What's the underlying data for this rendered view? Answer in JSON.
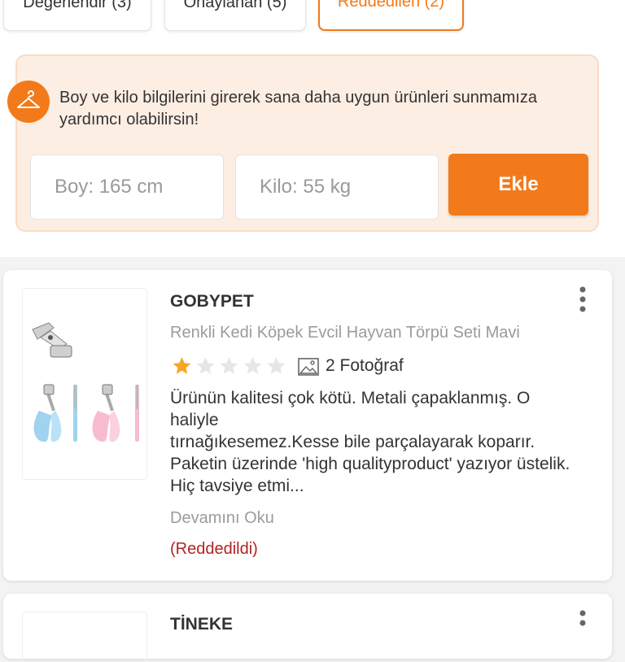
{
  "tabs": [
    {
      "label": "Değerlendir (3)"
    },
    {
      "label": "Onaylanan (5)"
    },
    {
      "label": "Reddedilen (2)",
      "active": true
    }
  ],
  "size_info": {
    "message": "Boy ve kilo bilgilerini girerek sana daha uygun ürünleri sunmamıza yardımcı olabilirsin!",
    "height_placeholder": "Boy: 165 cm",
    "weight_placeholder": "Kilo: 55 kg",
    "add_label": "Ekle",
    "icon": "hanger-icon"
  },
  "reviews": [
    {
      "brand": "GOBYPET",
      "product": "Renkli Kedi Köpek Evcil Hayvan Törpü Seti Mavi",
      "rating": 1,
      "rating_max": 5,
      "photo_count": "2 Fotoğraf",
      "text": "Ürünün kalitesi çok kötü. Metali çapaklanmış. O haliyle\ntırnağıkesemez.Kesse bile parçalayarak koparır. Paketin üzerinde 'high qualityproduct' yazıyor üstelik. Hiç tavsiye etmi...",
      "read_more": "Devamını Oku",
      "status": "(Reddedildi)"
    },
    {
      "brand": "TİNEKE"
    }
  ],
  "colors": {
    "accent": "#f27a1a",
    "star_filled": "#f5a623",
    "star_empty": "#e6e6e6",
    "rejected": "#b22222"
  }
}
